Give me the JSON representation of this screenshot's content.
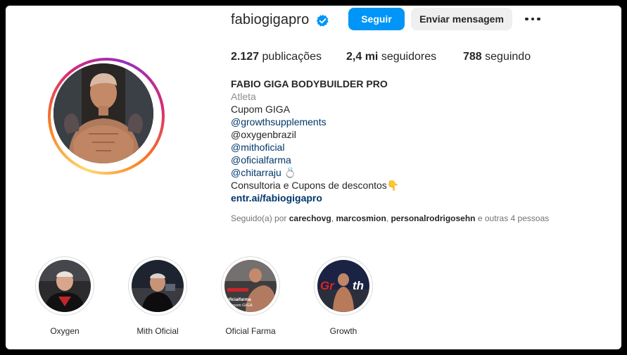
{
  "profile": {
    "username": "fabiogigapro",
    "follow_label": "Seguir",
    "message_label": "Enviar mensagem",
    "more_icon": "more-horizontal-icon",
    "verified_color": "#0095f6"
  },
  "stats": {
    "posts_count": "2.127",
    "posts_label": "publicações",
    "followers_count": "2,4 mi",
    "followers_label": "seguidores",
    "following_count": "788",
    "following_label": "seguindo"
  },
  "bio": {
    "full_name": "FABIO GIGA BODYBUILDER PRO",
    "category": "Atleta",
    "line1": "Cupom GIGA",
    "mention1": "@growthsupplements",
    "mention2": "@oxygenbrazil",
    "mention3": "@mithoficial",
    "mention4": "@oficialfarma",
    "mention5": "@chitarraju",
    "mention5_emoji": "💍",
    "line_consult": "Consultoria e Cupons de descontos",
    "line_consult_emoji": "👇",
    "link": "entr.ai/fabiogigapro"
  },
  "followed_by": {
    "prefix": "Seguido(a) por",
    "user1": "carechovg",
    "user2": "marcosmion",
    "user3": "personalrodrigosehn",
    "suffix": "e outras 4 pessoas"
  },
  "highlights": [
    {
      "label": "Oxygen"
    },
    {
      "label": "Mith Oficial"
    },
    {
      "label": "Oficial Farma",
      "image_text": "oficialfarma\nCupom GIGA"
    },
    {
      "label": "Growth",
      "image_text": "Growth"
    }
  ],
  "colors": {
    "accent": "#0095f6",
    "link": "#00376b",
    "muted": "#737373"
  }
}
